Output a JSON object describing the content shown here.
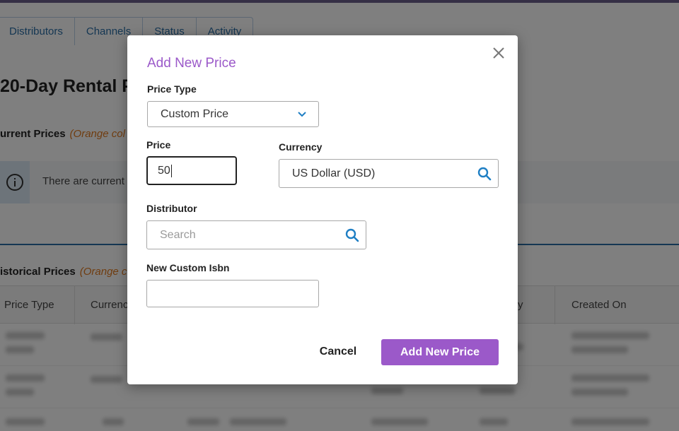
{
  "background": {
    "tabs": [
      "Distributors",
      "Channels",
      "Status",
      "Activity"
    ],
    "page_title": "20-Day Rental P",
    "current_prices": {
      "label": "urrent Prices",
      "note": "(Orange col"
    },
    "info_text": "There are current",
    "historical_prices": {
      "label": "istorical Prices",
      "note": "(Orange c"
    },
    "table_headers": [
      "Price Type",
      "Currenc",
      "y",
      "Created On"
    ]
  },
  "modal": {
    "title": "Add New Price",
    "price_type": {
      "label": "Price Type",
      "value": "Custom Price",
      "chevron_icon": "chevron-down-icon"
    },
    "price": {
      "label": "Price",
      "value": "50"
    },
    "currency": {
      "label": "Currency",
      "value": "US Dollar (USD)",
      "icon": "search-icon"
    },
    "distributor": {
      "label": "Distributor",
      "placeholder": "Search",
      "icon": "search-icon"
    },
    "custom_isbn": {
      "label": "New Custom Isbn",
      "value": ""
    },
    "cancel_label": "Cancel",
    "submit_label": "Add New Price",
    "close_icon": "close-icon"
  },
  "colors": {
    "accent_purple": "#9b59c9",
    "link_blue": "#2b6ea6",
    "search_icon_blue": "#1f7fc4",
    "note_orange": "#e07a20",
    "overlay": "rgba(0,0,0,0.5)"
  }
}
